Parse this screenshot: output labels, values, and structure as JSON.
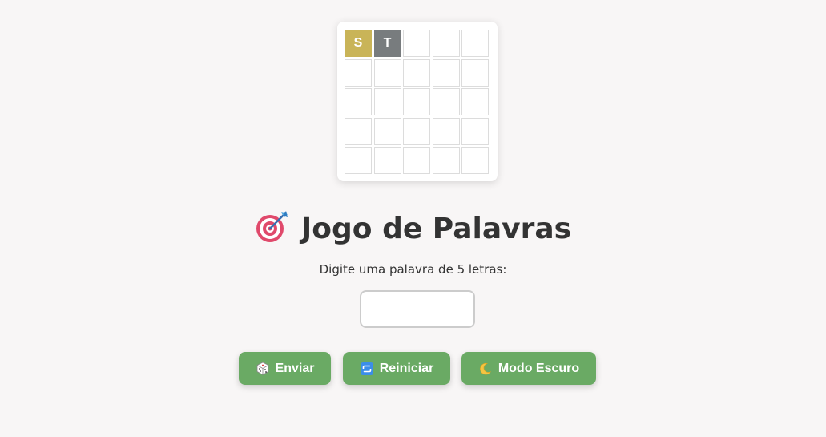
{
  "board": {
    "rows": [
      [
        {
          "letter": "S",
          "state": "present"
        },
        {
          "letter": "T",
          "state": "absent"
        },
        {
          "letter": "",
          "state": "empty"
        },
        {
          "letter": "",
          "state": "empty"
        },
        {
          "letter": "",
          "state": "empty"
        }
      ],
      [
        {
          "letter": "",
          "state": "empty"
        },
        {
          "letter": "",
          "state": "empty"
        },
        {
          "letter": "",
          "state": "empty"
        },
        {
          "letter": "",
          "state": "empty"
        },
        {
          "letter": "",
          "state": "empty"
        }
      ],
      [
        {
          "letter": "",
          "state": "empty"
        },
        {
          "letter": "",
          "state": "empty"
        },
        {
          "letter": "",
          "state": "empty"
        },
        {
          "letter": "",
          "state": "empty"
        },
        {
          "letter": "",
          "state": "empty"
        }
      ],
      [
        {
          "letter": "",
          "state": "empty"
        },
        {
          "letter": "",
          "state": "empty"
        },
        {
          "letter": "",
          "state": "empty"
        },
        {
          "letter": "",
          "state": "empty"
        },
        {
          "letter": "",
          "state": "empty"
        }
      ],
      [
        {
          "letter": "",
          "state": "empty"
        },
        {
          "letter": "",
          "state": "empty"
        },
        {
          "letter": "",
          "state": "empty"
        },
        {
          "letter": "",
          "state": "empty"
        },
        {
          "letter": "",
          "state": "empty"
        }
      ]
    ]
  },
  "header": {
    "title": "Jogo de Palavras",
    "title_icon": "direct-hit-target-icon"
  },
  "form": {
    "prompt": "Digite uma palavra de 5 letras:",
    "input_value": "",
    "input_placeholder": ""
  },
  "buttons": {
    "submit": {
      "label": "Enviar",
      "icon": "game-die-icon"
    },
    "restart": {
      "label": "Reiniciar",
      "icon": "repeat-arrows-icon"
    },
    "dark_mode": {
      "label": "Modo Escuro",
      "icon": "crescent-moon-icon"
    }
  },
  "colors": {
    "background": "#f8f6f6",
    "present": "#c9b458",
    "absent": "#787c7e",
    "button": "#6aaa64",
    "text": "#333333"
  }
}
